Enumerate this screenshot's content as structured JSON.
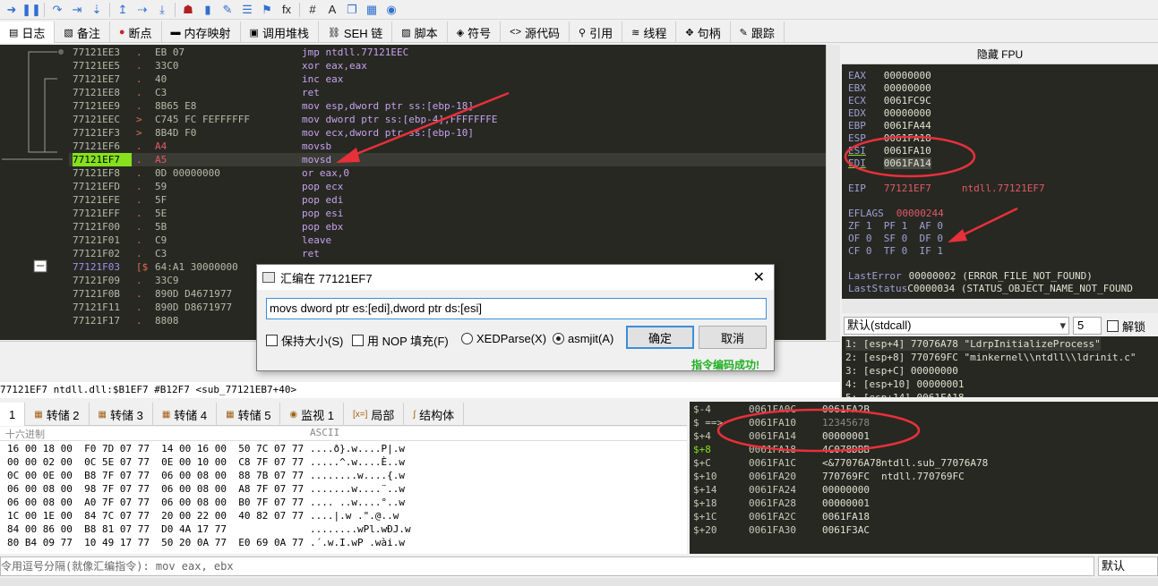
{
  "toolbar_icons": [
    "step-into-icon",
    "pause-icon",
    "step-over-icon",
    "step-out-icon",
    "run-to-icon",
    "trace-into-icon",
    "trace-over-icon",
    "execute-till-return-icon",
    "user-icon",
    "bookmark-icon",
    "patch-icon",
    "comment-icon",
    "label-icon",
    "function-icon",
    "hash-icon",
    "font-icon",
    "copy-icon",
    "calculator-icon",
    "globe-icon"
  ],
  "tabs": [
    {
      "label": "日志",
      "icon": "log-icon"
    },
    {
      "label": "备注",
      "icon": "notes-icon"
    },
    {
      "label": "断点",
      "icon": "breakpoint-icon"
    },
    {
      "label": "内存映射",
      "icon": "memory-map-icon"
    },
    {
      "label": "调用堆栈",
      "icon": "call-stack-icon"
    },
    {
      "label": "SEH 链",
      "icon": "seh-icon"
    },
    {
      "label": "脚本",
      "icon": "script-icon"
    },
    {
      "label": "符号",
      "icon": "symbol-icon"
    },
    {
      "label": "源代码",
      "icon": "source-icon"
    },
    {
      "label": "引用",
      "icon": "reference-icon"
    },
    {
      "label": "线程",
      "icon": "thread-icon"
    },
    {
      "label": "句柄",
      "icon": "handle-icon"
    },
    {
      "label": "跟踪",
      "icon": "trace-icon"
    }
  ],
  "disasm": [
    {
      "addr": "77121EE3",
      "mark": ".",
      "bytes": "EB 07",
      "instr": "jmp ntdll.77121EEC"
    },
    {
      "addr": "77121EE5",
      "mark": ".",
      "bytes": "33C0",
      "instr": "xor eax,eax"
    },
    {
      "addr": "77121EE7",
      "mark": ".",
      "bytes": "40",
      "instr": "inc eax"
    },
    {
      "addr": "77121EE8",
      "mark": ".",
      "bytes": "C3",
      "instr": "ret"
    },
    {
      "addr": "77121EE9",
      "mark": ".",
      "bytes": "8B65 E8",
      "instr": "mov esp,dword ptr ss:[ebp-18]"
    },
    {
      "addr": "77121EEC",
      "mark": ">",
      "bytes": "C745 FC FEFFFFFF",
      "instr": "mov dword ptr ss:[ebp-4],FFFFFFFE"
    },
    {
      "addr": "77121EF3",
      "mark": ">",
      "bytes": "8B4D F0",
      "instr": "mov ecx,dword ptr ss:[ebp-10]"
    },
    {
      "addr": "77121EF6",
      "mark": ".",
      "bytes": "A4",
      "instr": "movsb"
    },
    {
      "addr": "77121EF7",
      "mark": ".",
      "bytes": "A5",
      "instr": "movsd"
    },
    {
      "addr": "77121EF8",
      "mark": ".",
      "bytes": "0D 00000000",
      "instr": "or eax,0"
    },
    {
      "addr": "77121EFD",
      "mark": ".",
      "bytes": "59",
      "instr": "pop ecx"
    },
    {
      "addr": "77121EFE",
      "mark": ".",
      "bytes": "5F",
      "instr": "pop edi"
    },
    {
      "addr": "77121EFF",
      "mark": ".",
      "bytes": "5E",
      "instr": "pop esi"
    },
    {
      "addr": "77121F00",
      "mark": ".",
      "bytes": "5B",
      "instr": "pop ebx"
    },
    {
      "addr": "77121F01",
      "mark": ".",
      "bytes": "C9",
      "instr": "leave"
    },
    {
      "addr": "77121F02",
      "mark": ".",
      "bytes": "C3",
      "instr": "ret"
    },
    {
      "addr": "77121F03",
      "mark": "[$",
      "bytes": "64:A1 30000000",
      "instr": ""
    },
    {
      "addr": "77121F09",
      "mark": ".",
      "bytes": "33C9",
      "instr": ""
    },
    {
      "addr": "77121F0B",
      "mark": ".",
      "bytes": "890D D4671977",
      "instr": ""
    },
    {
      "addr": "77121F11",
      "mark": ".",
      "bytes": "890D D8671977",
      "instr": ""
    },
    {
      "addr": "77121F17",
      "mark": ".",
      "bytes": "8808",
      "instr": ""
    }
  ],
  "registers_header": "隐藏 FPU",
  "registers": [
    {
      "name": "EAX",
      "value": "00000000"
    },
    {
      "name": "EBX",
      "value": "00000000"
    },
    {
      "name": "ECX",
      "value": "0061FC9C"
    },
    {
      "name": "EDX",
      "value": "00000000"
    },
    {
      "name": "EBP",
      "value": "0061FA44"
    },
    {
      "name": "ESP",
      "value": "0061FA18"
    },
    {
      "name": "ESI",
      "value": "0061FA10"
    },
    {
      "name": "EDI",
      "value": "0061FA14"
    }
  ],
  "eip": {
    "name": "EIP",
    "value": "77121EF7",
    "comment": "ntdll.77121EF7"
  },
  "eflags": {
    "name": "EFLAGS",
    "value": "00000244"
  },
  "flags_rows": [
    "ZF 1  PF 1  AF 0",
    "OF 0  SF 0  DF 0",
    "CF 0  TF 0  IF 1"
  ],
  "last_error": {
    "label": "LastError",
    "value": "00000002 (ERROR_FILE_NOT_FOUND)"
  },
  "last_status": {
    "label": "LastStatus",
    "value": "C0000034 (STATUS_OBJECT_NAME_NOT_FOUND"
  },
  "callconv": {
    "value": "默认(stdcall)",
    "count": "5",
    "unlock_label": "解锁"
  },
  "args": [
    "1: [esp+4] 77076A78 \"LdrpInitializeProcess\"",
    "2: [esp+8] 770769FC \"minkernel\\\\ntdll\\\\ldrinit.c\"",
    "3: [esp+C] 00000000",
    "4: [esp+10] 00000001",
    "5: [esp+14] 0061FA18"
  ],
  "info_line": "77121EF7 ntdll.dll:$B1EF7 #B12F7 <sub_77121EB7+40>",
  "dump_tabs": [
    {
      "label": "1",
      "icon": ""
    },
    {
      "label": "转储 2",
      "icon": "dump-icon"
    },
    {
      "label": "转储 3",
      "icon": "dump-icon"
    },
    {
      "label": "转储 4",
      "icon": "dump-icon"
    },
    {
      "label": "转储 5",
      "icon": "dump-icon"
    },
    {
      "label": "监视 1",
      "icon": "watch-icon"
    },
    {
      "label": "局部",
      "icon": "locals-icon"
    },
    {
      "label": "结构体",
      "icon": "struct-icon"
    }
  ],
  "dump_header": {
    "hex": "十六进制",
    "ascii": "ASCII"
  },
  "dump_rows": [
    {
      "hex": "16 00 18 00  F0 7D 07 77  14 00 16 00  50 7C 07 77",
      "ascii": "....ð}.w....P|.w"
    },
    {
      "hex": "00 00 02 00  0C 5E 07 77  0E 00 10 00  C8 7F 07 77",
      "ascii": ".....^.w....È..w"
    },
    {
      "hex": "0C 00 0E 00  B8 7F 07 77  06 00 08 00  88 7B 07 77",
      "ascii": "........w....{.w"
    },
    {
      "hex": "06 00 08 00  98 7F 07 77  06 00 08 00  A8 7F 07 77",
      "ascii": ".......w....¨..w"
    },
    {
      "hex": "06 00 08 00  A0 7F 07 77  06 00 08 00  B0 7F 07 77",
      "ascii": ".... ..w....°..w"
    },
    {
      "hex": "1C 00 1E 00  84 7C 07 77  20 00 22 00  40 82 07 77",
      "ascii": "....|.w .\".@..w"
    },
    {
      "hex": "84 00 86 00  B8 81 07 77  D0 4A 17 77",
      "ascii": "........wPl.wÐJ.w"
    },
    {
      "hex": "80 B4 09 77  10 49 17 77  50 20 0A 77  E0 69 0A 77",
      "ascii": ".´.w.I.wP .wài.w"
    }
  ],
  "stack_rows": [
    {
      "off": "$-4",
      "addr": "0061FA0C",
      "val": "0061FA2B",
      "cmt": ""
    },
    {
      "off": "$ ==>",
      "addr": "0061FA10",
      "val": "12345678",
      "cmt": ""
    },
    {
      "off": "$+4",
      "addr": "0061FA14",
      "val": "00000001",
      "cmt": ""
    },
    {
      "off": "$+8",
      "addr": "0061FA18",
      "val": "4C078DBB",
      "cmt": ""
    },
    {
      "off": "$+C",
      "addr": "0061FA1C",
      "val": "<&77076A78",
      "cmt": "ntdll.sub_77076A78"
    },
    {
      "off": "$+10",
      "addr": "0061FA20",
      "val": "770769FC",
      "cmt": "ntdll.770769FC"
    },
    {
      "off": "$+14",
      "addr": "0061FA24",
      "val": "00000000",
      "cmt": ""
    },
    {
      "off": "$+18",
      "addr": "0061FA28",
      "val": "00000001",
      "cmt": ""
    },
    {
      "off": "$+1C",
      "addr": "0061FA2C",
      "val": "0061FA18",
      "cmt": ""
    },
    {
      "off": "$+20",
      "addr": "0061FA30",
      "val": "0061F3AC",
      "cmt": ""
    }
  ],
  "command": {
    "placeholder": "令用逗号分隔(就像汇编指令): mov eax, ebx",
    "mode": "默认"
  },
  "dialog": {
    "title": "汇编在 77121EF7",
    "input": "movs dword ptr es:[edi],dword ptr ds:[esi]",
    "keep_size": "保持大小(S)",
    "nop_fill": "用 NOP 填充(F)",
    "xedparse": "XEDParse(X)",
    "asmjit": "asmjit(A)",
    "ok": "确定",
    "cancel": "取消",
    "status": "指令编码成功!"
  },
  "colors": {
    "panel_bg": "#272822",
    "current_line": "#86e01e",
    "annotation": "#e8303a",
    "success": "#20b020"
  }
}
